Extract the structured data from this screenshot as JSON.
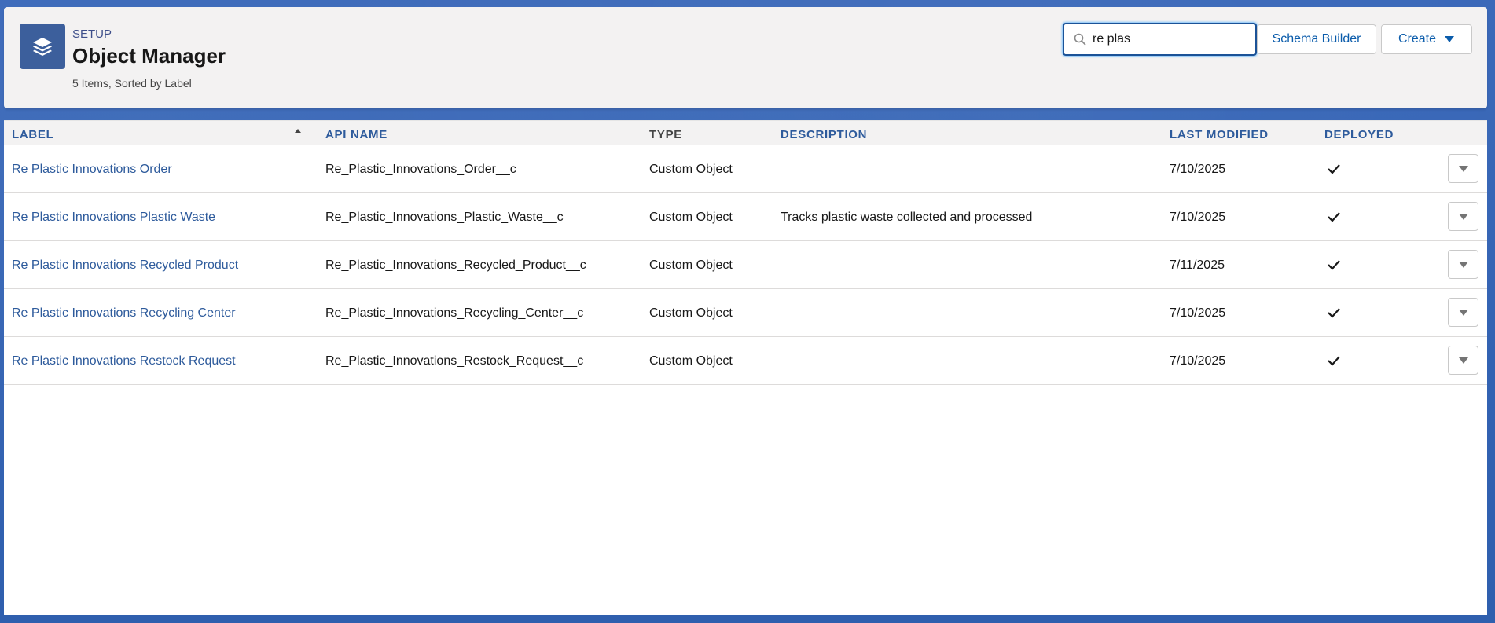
{
  "header": {
    "setup_label": "SETUP",
    "title": "Object Manager",
    "summary": "5 Items, Sorted by Label",
    "icon": "layers-icon"
  },
  "search": {
    "value": "re plas",
    "icon": "search-icon"
  },
  "buttons": {
    "schema_builder": "Schema Builder",
    "create": "Create"
  },
  "table": {
    "columns": {
      "label": "LABEL",
      "api_name": "API NAME",
      "type": "TYPE",
      "description": "DESCRIPTION",
      "last_modified": "LAST MODIFIED",
      "deployed": "DEPLOYED"
    },
    "sort": {
      "column": "label",
      "direction": "ascending"
    },
    "rows": [
      {
        "label": "Re Plastic Innovations Order",
        "api_name": "Re_Plastic_Innovations_Order__c",
        "type": "Custom Object",
        "description": "",
        "last_modified": "7/10/2025",
        "deployed": true
      },
      {
        "label": "Re Plastic Innovations Plastic Waste",
        "api_name": "Re_Plastic_Innovations_Plastic_Waste__c",
        "type": "Custom Object",
        "description": "Tracks plastic waste collected and processed",
        "last_modified": "7/10/2025",
        "deployed": true
      },
      {
        "label": "Re Plastic Innovations Recycled Product",
        "api_name": "Re_Plastic_Innovations_Recycled_Product__c",
        "type": "Custom Object",
        "description": "",
        "last_modified": "7/11/2025",
        "deployed": true
      },
      {
        "label": "Re Plastic Innovations Recycling Center",
        "api_name": "Re_Plastic_Innovations_Recycling_Center__c",
        "type": "Custom Object",
        "description": "",
        "last_modified": "7/10/2025",
        "deployed": true
      },
      {
        "label": "Re Plastic Innovations Restock Request",
        "api_name": "Re_Plastic_Innovations_Restock_Request__c",
        "type": "Custom Object",
        "description": "",
        "last_modified": "7/10/2025",
        "deployed": true
      }
    ]
  },
  "colors": {
    "brand_blue": "#0b5cab",
    "link_blue": "#2e5b9c",
    "icon_bg": "#3c5f9c"
  }
}
